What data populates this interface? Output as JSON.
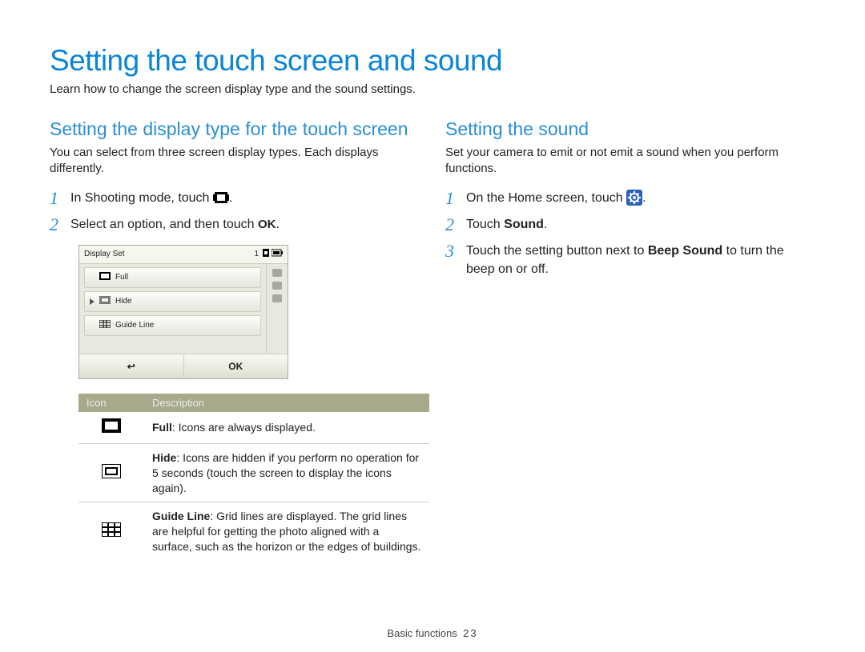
{
  "page": {
    "title": "Setting the touch screen and sound",
    "intro": "Learn how to change the screen display type and the sound settings.",
    "footer_section": "Basic functions",
    "page_number": "23"
  },
  "left": {
    "heading": "Setting the display type for the touch screen",
    "desc": "You can select from three screen display types. Each displays differently.",
    "steps": [
      {
        "text": "In Shooting mode, touch ",
        "icon_after": "display-icon",
        "tail": "."
      },
      {
        "text": "Select an option, and then touch ",
        "icon_after": "ok-text",
        "tail": "."
      }
    ],
    "camera": {
      "header_title": "Display Set",
      "header_right": "1",
      "options": [
        {
          "label": "Full",
          "selected": false
        },
        {
          "label": "Hide",
          "selected": true
        },
        {
          "label": "Guide Line",
          "selected": false
        }
      ],
      "back_label": "↩",
      "ok_label": "OK"
    },
    "table": {
      "head_icon": "Icon",
      "head_desc": "Description",
      "rows": [
        {
          "icon": "full",
          "term": "Full",
          "desc": ": Icons are always displayed."
        },
        {
          "icon": "hide",
          "term": "Hide",
          "desc": ": Icons are hidden if you perform no operation for 5 seconds (touch the screen to display the icons again)."
        },
        {
          "icon": "grid",
          "term": "Guide Line",
          "desc": ": Grid lines are displayed. The grid lines are helpful for getting the photo aligned with a surface, such as the horizon or the edges of buildings."
        }
      ]
    }
  },
  "right": {
    "heading": "Setting the sound",
    "desc": "Set your camera to emit or not emit a sound when you perform functions.",
    "steps": [
      {
        "text": "On the Home screen, touch ",
        "icon_after": "gear-icon",
        "tail": "."
      },
      {
        "text": "Touch ",
        "bold": "Sound",
        "tail": "."
      },
      {
        "text": "Touch the setting button next to ",
        "bold": "Beep Sound",
        "tail": " to turn the beep on or off."
      }
    ]
  }
}
